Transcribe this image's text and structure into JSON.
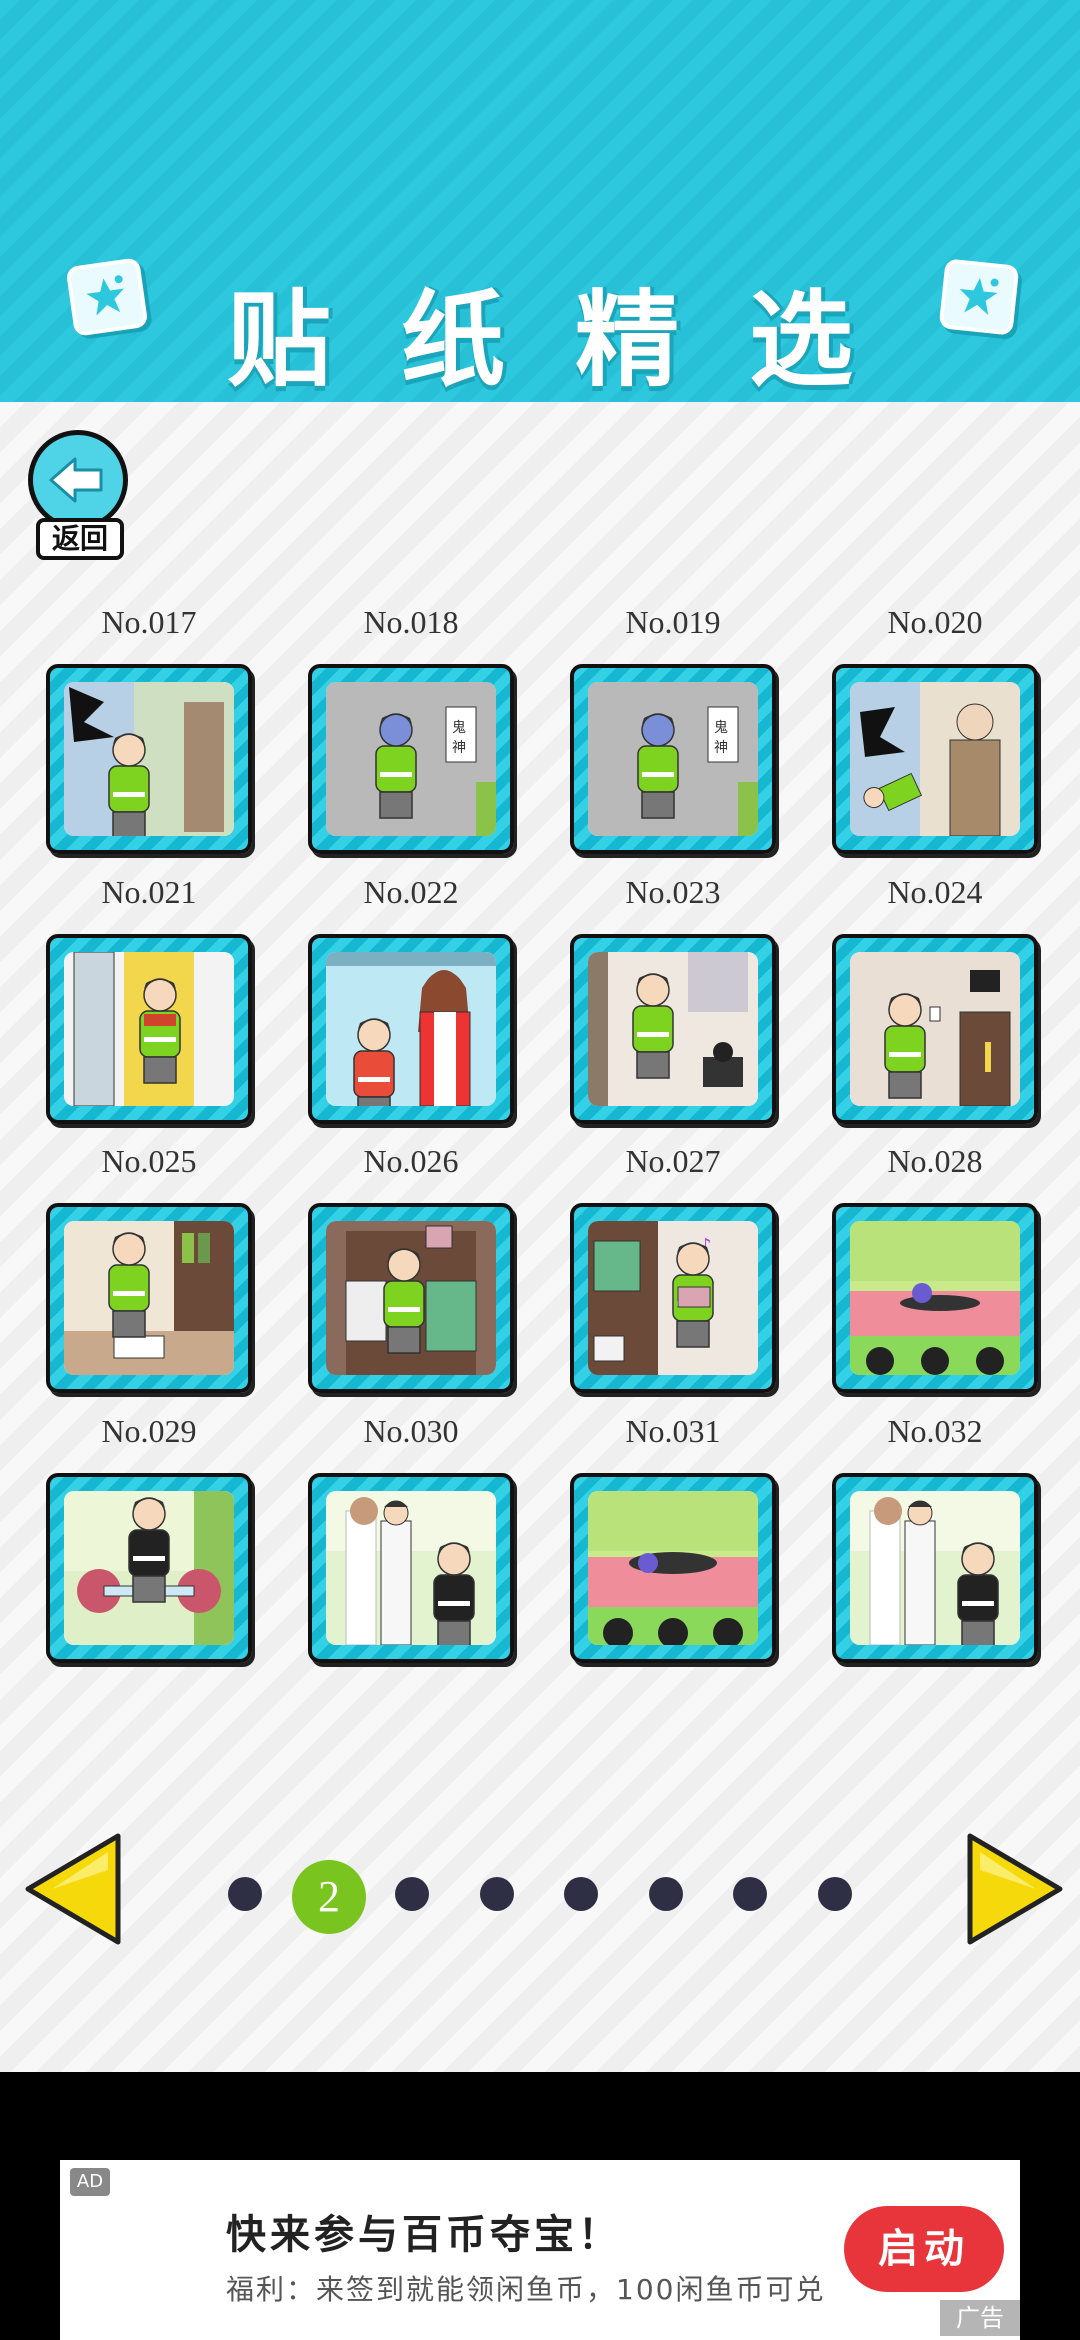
{
  "header": {
    "title": "贴纸精选"
  },
  "back_button": {
    "label": "返回"
  },
  "stickers": [
    {
      "label": "No.017",
      "scene": "wall-break"
    },
    {
      "label": "No.018",
      "scene": "ghost-blue"
    },
    {
      "label": "No.019",
      "scene": "ghost-blue"
    },
    {
      "label": "No.020",
      "scene": "wall-break-old"
    },
    {
      "label": "No.021",
      "scene": "door"
    },
    {
      "label": "No.022",
      "scene": "mom"
    },
    {
      "label": "No.023",
      "scene": "phone"
    },
    {
      "label": "No.024",
      "scene": "phone-room"
    },
    {
      "label": "No.025",
      "scene": "book"
    },
    {
      "label": "No.026",
      "scene": "cabinet"
    },
    {
      "label": "No.027",
      "scene": "box"
    },
    {
      "label": "No.028",
      "scene": "stage"
    },
    {
      "label": "No.029",
      "scene": "wedding-flowers"
    },
    {
      "label": "No.030",
      "scene": "wedding-couple"
    },
    {
      "label": "No.031",
      "scene": "stage-lying"
    },
    {
      "label": "No.032",
      "scene": "wedding-couple"
    }
  ],
  "pager": {
    "current": "2",
    "total_dots": 8,
    "active_index": 1
  },
  "ad": {
    "badge": "AD",
    "title": "快来参与百币夺宝！",
    "subtitle": "福利：来签到就能领闲鱼币，100闲鱼币可兑",
    "cta": "启动",
    "mark": "广告"
  },
  "colors": {
    "header": "#2ec8de",
    "card": "#33d0e6",
    "active_dot": "#7ac41f",
    "arrow": "#f5d90a",
    "cta": "#e8353c"
  }
}
